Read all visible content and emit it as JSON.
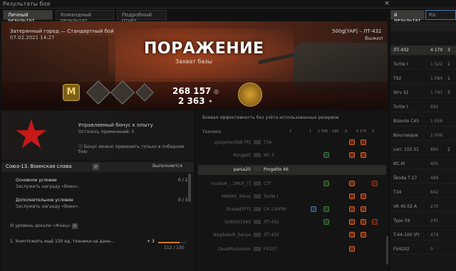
{
  "window": {
    "title": "Результаты боя",
    "close": "×"
  },
  "tabs": [
    {
      "label": "Личный результат",
      "active": true
    },
    {
      "label": "Командный результат",
      "active": false
    },
    {
      "label": "Подробный отчёт",
      "active": false
    }
  ],
  "right_tabs": [
    "й результат",
    "Ко"
  ],
  "banner": {
    "map": "Затерянный город — Стандартный бой",
    "date": "07.02.2021 14:27",
    "player": "500g[YAP] – ЛТ-432",
    "status": "Выжил",
    "result": "ПОРАЖЕНИЕ",
    "reason": "Захват базы",
    "credits": "268 157",
    "xp": "2 363",
    "medal_letter": "M"
  },
  "bonus": {
    "title": "Управляемый бонус к опыту",
    "uses": "Осталось применений: 5",
    "note": "Бонус можно применить только в победном бою"
  },
  "quest": {
    "name": "Союз-13. Воинская слава",
    "arrow": ">",
    "state": "Выполняется",
    "main_title": "Основное условие",
    "main_sub": "Заслужить награду «Воин».",
    "main_count": "0 / 2",
    "add_title": "Дополнительное условие",
    "add_sub": "Заслужить награду «Воин».",
    "add_count": "0 / 3",
    "level": "III уровень декали «Жнец»",
    "task": "1. Уничтожить ещё 150 ед. техники на данн...",
    "plus": "+ 3",
    "progress": "112 / 150",
    "progress_fraction": 0.746
  },
  "efficiency": {
    "title": "Боевая эффективность без учёта использованных резервов",
    "header": "Техника",
    "cols": [
      "2",
      "-",
      "1",
      "1 506",
      "180",
      "8",
      "4 170",
      "3"
    ],
    "rows": [
      {
        "player": "vpojarkov[BB-TR]",
        "vehicle": "T34",
        "me": false
      },
      {
        "player": "Kongat5",
        "vehicle": "ИС-3",
        "me": false
      },
      {
        "player": "pania20",
        "vehicle": "Progetto 46",
        "me": true
      },
      {
        "player": "mushok_...[MLR_T]",
        "vehicle": "СТГ",
        "me": false
      },
      {
        "player": "MARKII_34rus",
        "vehicle": "Turtle I",
        "me": false
      },
      {
        "player": "Drawk[FFY]",
        "vehicle": "СУ-130ПМ",
        "me": false
      },
      {
        "player": "Gold163163",
        "vehicle": "ЛТ-432",
        "me": false
      },
      {
        "player": "NagibatoR_Sanya",
        "vehicle": "ЛТ-432",
        "me": false
      },
      {
        "player": "DeadRushroom",
        "vehicle": "FV207",
        "me": false
      }
    ]
  },
  "right_list": [
    {
      "v": "ЛТ-432",
      "x": "4 170",
      "k": "3",
      "hi": true
    },
    {
      "v": "Turtle I",
      "x": "1 522",
      "k": "1",
      "hi": false
    },
    {
      "v": "T92",
      "x": "1 084",
      "k": "1",
      "hi": false
    },
    {
      "v": "Strv S1",
      "x": "1 747",
      "k": "3",
      "hi": false
    },
    {
      "v": "Turtle I",
      "x": "691",
      "k": "",
      "hi": false
    },
    {
      "v": "Bisonte C45",
      "x": "1 056",
      "k": "",
      "hi": false
    },
    {
      "v": "Bourrasque",
      "x": "1 006",
      "k": "",
      "hi": false
    },
    {
      "v": "Lorr. 155 51",
      "x": "860",
      "k": "2",
      "hi": false
    },
    {
      "v": "ИС-М",
      "x": "405",
      "k": "",
      "hi": false
    },
    {
      "v": "Škoda T 27",
      "x": "489",
      "k": "",
      "hi": false
    },
    {
      "v": "T34",
      "x": "842",
      "k": "",
      "hi": false
    },
    {
      "v": "VK 45.02 A",
      "x": "270",
      "k": "",
      "hi": false
    },
    {
      "v": "Type 59",
      "x": "241",
      "k": "",
      "hi": false
    },
    {
      "v": "T-44-100 (P)",
      "x": "474",
      "k": "",
      "hi": false
    },
    {
      "v": "FV4202",
      "x": "0",
      "k": "",
      "hi": false
    }
  ]
}
